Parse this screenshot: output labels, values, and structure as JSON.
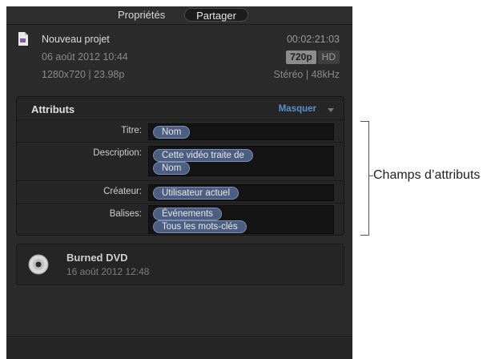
{
  "tabs": {
    "properties": "Propriétés",
    "share": "Partager"
  },
  "project": {
    "name": "Nouveau projet",
    "duration": "00:02:21:03",
    "date": "06 août 2012 10:44",
    "resolution": "1280x720  |  23.98p",
    "badge_720p": "720p",
    "badge_hd": "HD",
    "audio": "Stéréo  |  48kHz",
    "icon": "project-file-icon"
  },
  "attributes": {
    "heading": "Attributs",
    "hide": "Masquer",
    "rows": [
      {
        "label": "Titre:",
        "tokens": [
          "Nom"
        ]
      },
      {
        "label": "Description:",
        "tokens": [
          "Cette vidéo traite de",
          "Nom"
        ]
      },
      {
        "label": "Créateur:",
        "tokens": [
          "Utilisateur actuel"
        ]
      },
      {
        "label": "Balises:",
        "tokens": [
          "Événements",
          "Tous les mots-clés"
        ]
      }
    ]
  },
  "callout": "Champs d’attributs",
  "share_item": {
    "title": "Burned DVD",
    "date": "16 août 2012 12:48",
    "icon": "dvd-disc-icon"
  },
  "colors": {
    "panel": "#2b2b2b",
    "token": "#4c5f82",
    "link": "#5b8fd0"
  }
}
